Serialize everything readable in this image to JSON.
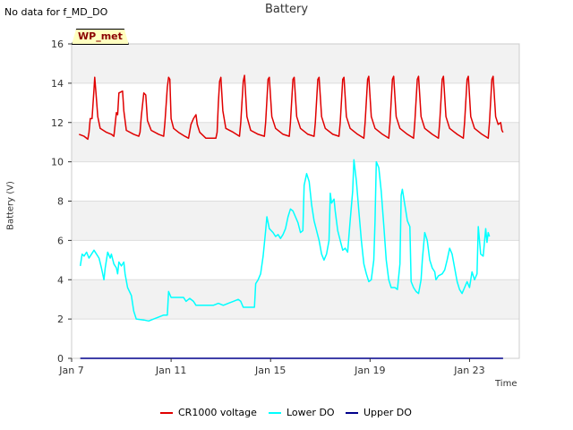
{
  "header": {
    "nodata_note": "No data for f_MD_DO",
    "wp_label": "WP_met"
  },
  "chart_data": {
    "type": "line",
    "title": "Battery",
    "xlabel": "Time",
    "ylabel": "Battery (V)",
    "xlim": [
      0,
      18
    ],
    "ylim": [
      0,
      16
    ],
    "xticks": [
      {
        "pos": 0,
        "label": "Jan 7"
      },
      {
        "pos": 4,
        "label": "Jan 11"
      },
      {
        "pos": 8,
        "label": "Jan 15"
      },
      {
        "pos": 12,
        "label": "Jan 19"
      },
      {
        "pos": 16,
        "label": "Jan 23"
      }
    ],
    "yticks": [
      0,
      2,
      4,
      6,
      8,
      10,
      12,
      14,
      16
    ],
    "grid": true,
    "legend_position": "bottom",
    "series": [
      {
        "name": "CR1000 voltage",
        "color": "#e00000",
        "points": [
          [
            0.3,
            11.4
          ],
          [
            0.5,
            11.3
          ],
          [
            0.65,
            11.15
          ],
          [
            0.7,
            11.5
          ],
          [
            0.75,
            12.2
          ],
          [
            0.82,
            12.2
          ],
          [
            0.9,
            13.7
          ],
          [
            0.93,
            14.3
          ],
          [
            0.98,
            13.5
          ],
          [
            1.05,
            12.3
          ],
          [
            1.15,
            11.7
          ],
          [
            1.4,
            11.5
          ],
          [
            1.6,
            11.4
          ],
          [
            1.7,
            11.3
          ],
          [
            1.75,
            11.9
          ],
          [
            1.8,
            12.5
          ],
          [
            1.85,
            12.4
          ],
          [
            1.9,
            13.5
          ],
          [
            2.05,
            13.6
          ],
          [
            2.1,
            12.6
          ],
          [
            2.2,
            11.6
          ],
          [
            2.5,
            11.4
          ],
          [
            2.7,
            11.3
          ],
          [
            2.75,
            11.5
          ],
          [
            2.8,
            12.3
          ],
          [
            2.9,
            13.5
          ],
          [
            2.98,
            13.4
          ],
          [
            3.05,
            12.1
          ],
          [
            3.2,
            11.6
          ],
          [
            3.5,
            11.4
          ],
          [
            3.7,
            11.3
          ],
          [
            3.75,
            12.0
          ],
          [
            3.85,
            13.8
          ],
          [
            3.9,
            14.3
          ],
          [
            3.95,
            14.2
          ],
          [
            4.0,
            12.2
          ],
          [
            4.1,
            11.7
          ],
          [
            4.3,
            11.5
          ],
          [
            4.55,
            11.3
          ],
          [
            4.7,
            11.2
          ],
          [
            4.8,
            11.9
          ],
          [
            4.9,
            12.2
          ],
          [
            5.0,
            12.4
          ],
          [
            5.05,
            11.9
          ],
          [
            5.15,
            11.5
          ],
          [
            5.4,
            11.2
          ],
          [
            5.8,
            11.2
          ],
          [
            5.85,
            11.5
          ],
          [
            5.9,
            13.0
          ],
          [
            5.95,
            14.1
          ],
          [
            6.0,
            14.3
          ],
          [
            6.08,
            12.6
          ],
          [
            6.2,
            11.7
          ],
          [
            6.5,
            11.5
          ],
          [
            6.75,
            11.3
          ],
          [
            6.8,
            12.0
          ],
          [
            6.9,
            14.1
          ],
          [
            6.95,
            14.4
          ],
          [
            7.05,
            12.3
          ],
          [
            7.2,
            11.6
          ],
          [
            7.5,
            11.4
          ],
          [
            7.75,
            11.3
          ],
          [
            7.8,
            12.0
          ],
          [
            7.9,
            14.2
          ],
          [
            7.95,
            14.3
          ],
          [
            8.05,
            12.3
          ],
          [
            8.2,
            11.7
          ],
          [
            8.5,
            11.4
          ],
          [
            8.75,
            11.3
          ],
          [
            8.8,
            12.0
          ],
          [
            8.9,
            14.2
          ],
          [
            8.95,
            14.3
          ],
          [
            9.05,
            12.3
          ],
          [
            9.2,
            11.7
          ],
          [
            9.5,
            11.4
          ],
          [
            9.75,
            11.3
          ],
          [
            9.8,
            12.0
          ],
          [
            9.9,
            14.2
          ],
          [
            9.95,
            14.3
          ],
          [
            10.05,
            12.3
          ],
          [
            10.2,
            11.7
          ],
          [
            10.5,
            11.4
          ],
          [
            10.75,
            11.3
          ],
          [
            10.8,
            12.0
          ],
          [
            10.9,
            14.2
          ],
          [
            10.95,
            14.3
          ],
          [
            11.05,
            12.3
          ],
          [
            11.2,
            11.7
          ],
          [
            11.5,
            11.4
          ],
          [
            11.75,
            11.2
          ],
          [
            11.8,
            12.0
          ],
          [
            11.9,
            14.2
          ],
          [
            11.95,
            14.35
          ],
          [
            12.05,
            12.3
          ],
          [
            12.2,
            11.7
          ],
          [
            12.5,
            11.4
          ],
          [
            12.75,
            11.2
          ],
          [
            12.8,
            12.0
          ],
          [
            12.9,
            14.2
          ],
          [
            12.95,
            14.35
          ],
          [
            13.05,
            12.3
          ],
          [
            13.2,
            11.7
          ],
          [
            13.5,
            11.4
          ],
          [
            13.75,
            11.2
          ],
          [
            13.8,
            12.0
          ],
          [
            13.9,
            14.2
          ],
          [
            13.95,
            14.35
          ],
          [
            14.05,
            12.3
          ],
          [
            14.2,
            11.7
          ],
          [
            14.5,
            11.4
          ],
          [
            14.75,
            11.2
          ],
          [
            14.8,
            12.0
          ],
          [
            14.9,
            14.2
          ],
          [
            14.95,
            14.35
          ],
          [
            15.05,
            12.3
          ],
          [
            15.2,
            11.7
          ],
          [
            15.5,
            11.4
          ],
          [
            15.75,
            11.2
          ],
          [
            15.8,
            12.0
          ],
          [
            15.9,
            14.2
          ],
          [
            15.95,
            14.35
          ],
          [
            16.05,
            12.3
          ],
          [
            16.2,
            11.7
          ],
          [
            16.5,
            11.4
          ],
          [
            16.75,
            11.2
          ],
          [
            16.8,
            12.0
          ],
          [
            16.9,
            14.2
          ],
          [
            16.95,
            14.35
          ],
          [
            17.05,
            12.3
          ],
          [
            17.15,
            11.9
          ],
          [
            17.25,
            12.0
          ],
          [
            17.3,
            11.6
          ],
          [
            17.35,
            11.5
          ]
        ]
      },
      {
        "name": "Lower DO",
        "color": "#00ffff",
        "points": [
          [
            0.35,
            4.7
          ],
          [
            0.42,
            5.3
          ],
          [
            0.5,
            5.2
          ],
          [
            0.6,
            5.4
          ],
          [
            0.7,
            5.1
          ],
          [
            0.8,
            5.3
          ],
          [
            0.9,
            5.5
          ],
          [
            1.0,
            5.3
          ],
          [
            1.1,
            5.1
          ],
          [
            1.2,
            4.6
          ],
          [
            1.3,
            4.0
          ],
          [
            1.35,
            4.6
          ],
          [
            1.45,
            5.4
          ],
          [
            1.55,
            5.1
          ],
          [
            1.6,
            5.3
          ],
          [
            1.7,
            4.8
          ],
          [
            1.8,
            4.6
          ],
          [
            1.85,
            4.3
          ],
          [
            1.9,
            4.9
          ],
          [
            2.0,
            4.7
          ],
          [
            2.1,
            4.9
          ],
          [
            2.15,
            4.3
          ],
          [
            2.25,
            3.6
          ],
          [
            2.4,
            3.2
          ],
          [
            2.5,
            2.4
          ],
          [
            2.6,
            2.0
          ],
          [
            2.9,
            1.95
          ],
          [
            3.1,
            1.9
          ],
          [
            3.3,
            2.0
          ],
          [
            3.5,
            2.1
          ],
          [
            3.7,
            2.2
          ],
          [
            3.85,
            2.2
          ],
          [
            3.9,
            3.4
          ],
          [
            4.0,
            3.1
          ],
          [
            4.3,
            3.1
          ],
          [
            4.5,
            3.1
          ],
          [
            4.6,
            2.9
          ],
          [
            4.75,
            3.05
          ],
          [
            4.9,
            2.9
          ],
          [
            5.0,
            2.7
          ],
          [
            5.3,
            2.7
          ],
          [
            5.5,
            2.7
          ],
          [
            5.7,
            2.7
          ],
          [
            5.9,
            2.8
          ],
          [
            6.1,
            2.7
          ],
          [
            6.3,
            2.8
          ],
          [
            6.5,
            2.9
          ],
          [
            6.7,
            3.0
          ],
          [
            6.8,
            2.9
          ],
          [
            6.9,
            2.6
          ],
          [
            7.2,
            2.6
          ],
          [
            7.35,
            2.6
          ],
          [
            7.4,
            3.8
          ],
          [
            7.5,
            4.0
          ],
          [
            7.6,
            4.3
          ],
          [
            7.7,
            5.2
          ],
          [
            7.8,
            6.5
          ],
          [
            7.85,
            7.2
          ],
          [
            7.95,
            6.6
          ],
          [
            8.1,
            6.4
          ],
          [
            8.2,
            6.2
          ],
          [
            8.3,
            6.3
          ],
          [
            8.4,
            6.1
          ],
          [
            8.5,
            6.3
          ],
          [
            8.6,
            6.6
          ],
          [
            8.7,
            7.2
          ],
          [
            8.8,
            7.6
          ],
          [
            8.9,
            7.5
          ],
          [
            9.0,
            7.2
          ],
          [
            9.1,
            6.9
          ],
          [
            9.2,
            6.4
          ],
          [
            9.3,
            6.5
          ],
          [
            9.35,
            8.8
          ],
          [
            9.45,
            9.4
          ],
          [
            9.55,
            9.0
          ],
          [
            9.65,
            7.8
          ],
          [
            9.75,
            7.0
          ],
          [
            9.85,
            6.5
          ],
          [
            9.95,
            6.0
          ],
          [
            10.05,
            5.3
          ],
          [
            10.15,
            5.0
          ],
          [
            10.25,
            5.3
          ],
          [
            10.35,
            6.0
          ],
          [
            10.4,
            8.4
          ],
          [
            10.45,
            7.9
          ],
          [
            10.55,
            8.1
          ],
          [
            10.6,
            7.5
          ],
          [
            10.7,
            6.5
          ],
          [
            10.8,
            6.0
          ],
          [
            10.9,
            5.5
          ],
          [
            11.0,
            5.6
          ],
          [
            11.1,
            5.4
          ],
          [
            11.2,
            7.0
          ],
          [
            11.3,
            8.5
          ],
          [
            11.35,
            10.1
          ],
          [
            11.45,
            9.0
          ],
          [
            11.55,
            7.5
          ],
          [
            11.65,
            6.0
          ],
          [
            11.75,
            4.8
          ],
          [
            11.85,
            4.3
          ],
          [
            11.95,
            3.9
          ],
          [
            12.05,
            4.0
          ],
          [
            12.15,
            5.0
          ],
          [
            12.2,
            7.0
          ],
          [
            12.25,
            10.0
          ],
          [
            12.35,
            9.7
          ],
          [
            12.45,
            8.5
          ],
          [
            12.55,
            6.8
          ],
          [
            12.65,
            5.0
          ],
          [
            12.75,
            4.0
          ],
          [
            12.85,
            3.6
          ],
          [
            13.0,
            3.6
          ],
          [
            13.1,
            3.5
          ],
          [
            13.2,
            4.8
          ],
          [
            13.25,
            8.3
          ],
          [
            13.3,
            8.6
          ],
          [
            13.4,
            7.8
          ],
          [
            13.5,
            7.0
          ],
          [
            13.6,
            6.7
          ],
          [
            13.65,
            3.9
          ],
          [
            13.75,
            3.6
          ],
          [
            13.85,
            3.4
          ],
          [
            13.95,
            3.3
          ],
          [
            14.05,
            4.0
          ],
          [
            14.1,
            5.0
          ],
          [
            14.2,
            6.4
          ],
          [
            14.3,
            6.0
          ],
          [
            14.4,
            5.0
          ],
          [
            14.5,
            4.6
          ],
          [
            14.6,
            4.4
          ],
          [
            14.65,
            4.0
          ],
          [
            14.75,
            4.2
          ],
          [
            14.9,
            4.3
          ],
          [
            15.0,
            4.5
          ],
          [
            15.1,
            5.0
          ],
          [
            15.2,
            5.6
          ],
          [
            15.3,
            5.3
          ],
          [
            15.4,
            4.6
          ],
          [
            15.5,
            3.9
          ],
          [
            15.6,
            3.5
          ],
          [
            15.7,
            3.3
          ],
          [
            15.8,
            3.6
          ],
          [
            15.9,
            3.9
          ],
          [
            16.0,
            3.6
          ],
          [
            16.1,
            4.4
          ],
          [
            16.2,
            4.0
          ],
          [
            16.3,
            4.3
          ],
          [
            16.35,
            6.7
          ],
          [
            16.45,
            5.3
          ],
          [
            16.55,
            5.2
          ],
          [
            16.65,
            6.6
          ],
          [
            16.7,
            5.9
          ],
          [
            16.75,
            6.4
          ],
          [
            16.8,
            6.2
          ]
        ]
      },
      {
        "name": "Upper DO",
        "color": "#00008b",
        "points": [
          [
            0.35,
            0.0
          ],
          [
            17.35,
            0.0
          ]
        ]
      }
    ]
  }
}
